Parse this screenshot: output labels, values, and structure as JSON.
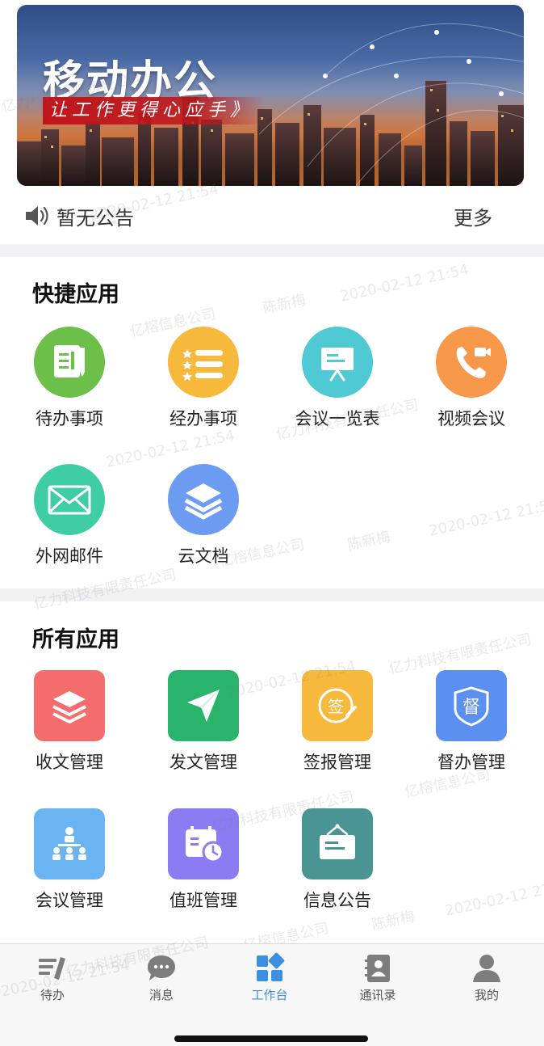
{
  "banner": {
    "title": "移动办公",
    "subtitle": "让工作更得心应手》"
  },
  "notice": {
    "text": "暂无公告",
    "more": "更多"
  },
  "quick_apps": {
    "title": "快捷应用",
    "items": [
      {
        "label": "待办事项",
        "icon": "todo-icon",
        "color": "#6cc04a"
      },
      {
        "label": "经办事项",
        "icon": "checklist-icon",
        "color": "#f6b93b"
      },
      {
        "label": "会议一览表",
        "icon": "presentation-board-icon",
        "color": "#4fc9d3"
      },
      {
        "label": "视频会议",
        "icon": "video-call-icon",
        "color": "#f7974a"
      },
      {
        "label": "外网邮件",
        "icon": "mail-icon",
        "color": "#3fcda4"
      },
      {
        "label": "云文档",
        "icon": "cloud-docs-stack-icon",
        "color": "#6b9cf1"
      }
    ]
  },
  "all_apps": {
    "title": "所有应用",
    "items": [
      {
        "label": "收文管理",
        "icon": "layers-icon",
        "color": "#f46d6d"
      },
      {
        "label": "发文管理",
        "icon": "paper-plane-icon",
        "color": "#29b36b"
      },
      {
        "label": "签报管理",
        "icon": "sign-stamp-icon",
        "color": "#f6b93b",
        "glyph": "签"
      },
      {
        "label": "督办管理",
        "icon": "supervise-badge-icon",
        "color": "#5b8ff0",
        "glyph": "督"
      },
      {
        "label": "会议管理",
        "icon": "meeting-people-icon",
        "color": "#6bb4f2"
      },
      {
        "label": "值班管理",
        "icon": "duty-calendar-icon",
        "color": "#8c7cf3"
      },
      {
        "label": "信息公告",
        "icon": "notice-board-icon",
        "color": "#4a9593"
      }
    ]
  },
  "tabbar": {
    "items": [
      {
        "label": "待办",
        "icon": "todo-list-icon",
        "active": false
      },
      {
        "label": "消息",
        "icon": "chat-bubble-icon",
        "active": false
      },
      {
        "label": "工作台",
        "icon": "workbench-grid-icon",
        "active": true
      },
      {
        "label": "通讯录",
        "icon": "contacts-book-icon",
        "active": false
      },
      {
        "label": "我的",
        "icon": "person-icon",
        "active": false
      }
    ]
  },
  "watermark": {
    "company_a": "亿榕信息公司",
    "company_b": "亿力科技有限责任公司",
    "name": "陈新梅",
    "timestamp": "2020-02-12 21:54"
  },
  "colors": {
    "accent": "#3d8fe0",
    "divider": "#f1f1f3"
  }
}
